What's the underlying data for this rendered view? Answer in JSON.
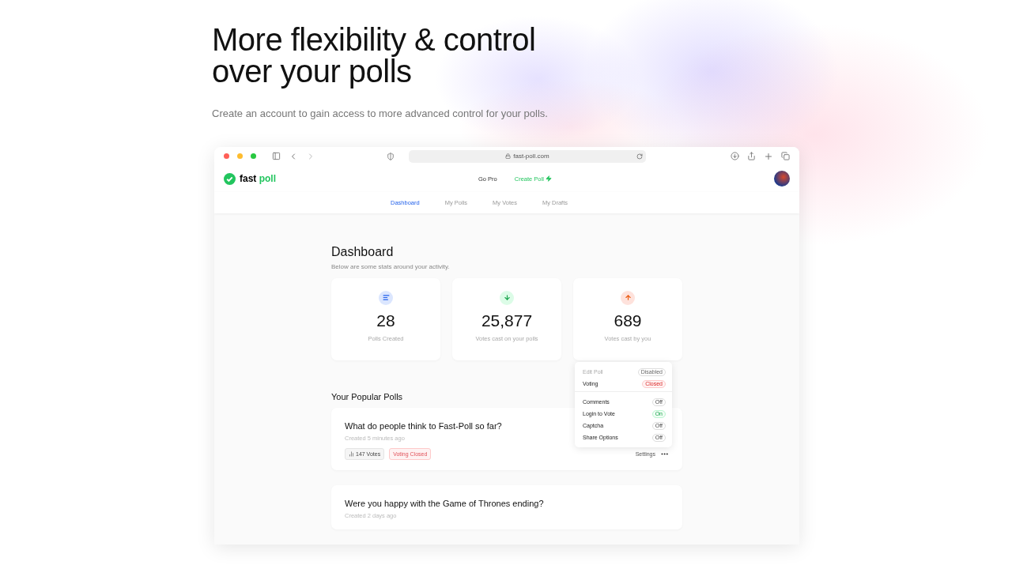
{
  "hero": {
    "title": "More flexibility & control over your polls",
    "subtitle": "Create an account to gain access to more advanced control for your polls."
  },
  "browser": {
    "url": "fast-poll.com"
  },
  "app": {
    "logo": {
      "first": "fast",
      "second": "poll"
    },
    "header_links": [
      {
        "label": "Go Pro",
        "kind": "plain"
      },
      {
        "label": "Create Poll",
        "kind": "accent"
      }
    ],
    "tabs": [
      {
        "label": "Dashboard",
        "selected": true
      },
      {
        "label": "My Polls",
        "selected": false
      },
      {
        "label": "My Votes",
        "selected": false
      },
      {
        "label": "My Drafts",
        "selected": false
      }
    ],
    "dashboard": {
      "title": "Dashboard",
      "subtitle": "Below are some stats around your activity.",
      "stats": [
        {
          "kind": "list",
          "value": "28",
          "label": "Polls Created"
        },
        {
          "kind": "down",
          "value": "25,877",
          "label": "Votes cast on your polls"
        },
        {
          "kind": "up",
          "value": "689",
          "label": "Votes cast by you"
        }
      ]
    },
    "popular": {
      "title": "Your Popular Polls",
      "polls": [
        {
          "question": "What do people think to Fast-Poll so far?",
          "created": "Created 5 minutes ago",
          "tags": [
            {
              "kind": "votes",
              "text": "147 Votes"
            },
            {
              "kind": "status",
              "text": "Voting Closed",
              "open": false
            }
          ],
          "settings": "Settings"
        },
        {
          "question": "Were you happy with the Game of Thrones ending?",
          "created": "Created 2 days ago"
        }
      ]
    },
    "menu": {
      "groups": [
        [
          {
            "kind": "status",
            "label": "Edit Poll",
            "badge": "Disabled",
            "disabled": true
          },
          {
            "kind": "status",
            "label": "Voting",
            "badge": "Closed",
            "disabled": false,
            "open": false
          }
        ],
        [
          {
            "kind": "toggle",
            "label": "Comments",
            "badge": "Off",
            "on": false
          },
          {
            "kind": "toggle",
            "label": "Login to Vote",
            "badge": "On",
            "on": true
          },
          {
            "kind": "toggle",
            "label": "Captcha",
            "badge": "Off",
            "on": false
          },
          {
            "kind": "toggle",
            "label": "Share Options",
            "badge": "Off",
            "on": false
          }
        ]
      ]
    }
  }
}
